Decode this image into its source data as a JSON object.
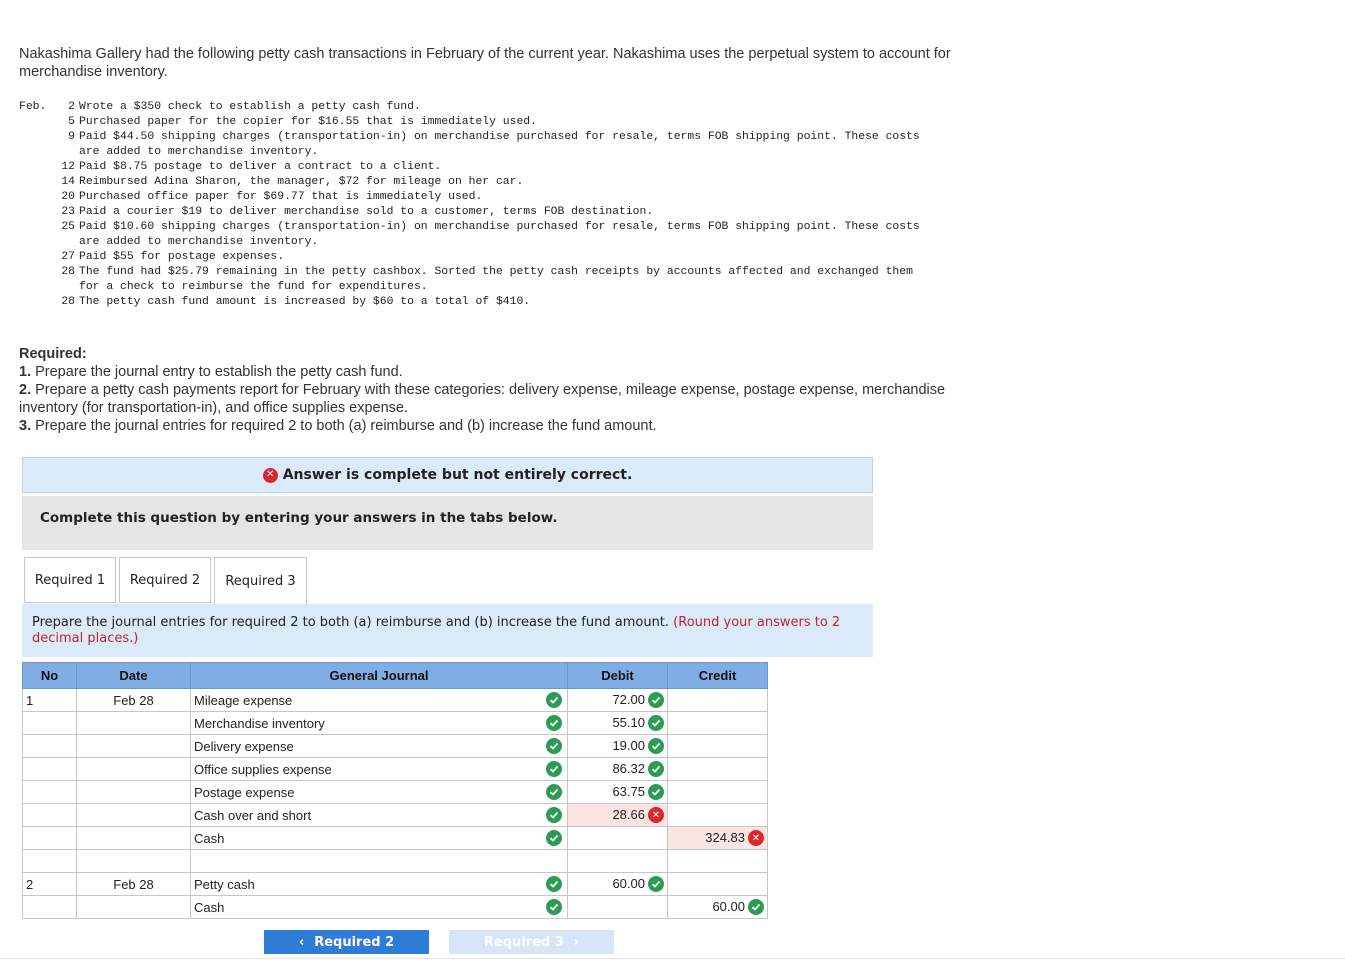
{
  "intro": "Nakashima Gallery had the following petty cash transactions in February of the current year. Nakashima uses the perpetual system to account for merchandise inventory.",
  "month": "Feb.",
  "transactions": [
    {
      "day": "2",
      "text": "Wrote a $350 check to establish a petty cash fund."
    },
    {
      "day": "5",
      "text": "Purchased paper for the copier for $16.55 that is immediately used."
    },
    {
      "day": "9",
      "text": "Paid $44.50 shipping charges (transportation-in) on merchandise purchased for resale, terms FOB shipping point. These costs\nare added to merchandise inventory."
    },
    {
      "day": "12",
      "text": "Paid $8.75 postage to deliver a contract to a client."
    },
    {
      "day": "14",
      "text": "Reimbursed Adina Sharon, the manager, $72 for mileage on her car."
    },
    {
      "day": "20",
      "text": "Purchased office paper for $69.77 that is immediately used."
    },
    {
      "day": "23",
      "text": "Paid a courier $19 to deliver merchandise sold to a customer, terms FOB destination."
    },
    {
      "day": "25",
      "text": "Paid $10.60 shipping charges (transportation-in) on merchandise purchased for resale, terms FOB shipping point. These costs\nare added to merchandise inventory."
    },
    {
      "day": "27",
      "text": "Paid $55 for postage expenses."
    },
    {
      "day": "28",
      "text": "The fund had $25.79 remaining in the petty cashbox. Sorted the petty cash receipts by accounts affected and exchanged them\nfor a check to reimburse the fund for expenditures."
    },
    {
      "day": "28",
      "text": "The petty cash fund amount is increased by $60 to a total of $410."
    }
  ],
  "required": {
    "heading": "Required:",
    "items": [
      {
        "num": "1.",
        "text": " Prepare the journal entry to establish the petty cash fund."
      },
      {
        "num": "2.",
        "text": " Prepare a petty cash payments report for February with these categories: delivery expense, mileage expense, postage expense, merchandise inventory (for transportation-in), and office supplies expense."
      },
      {
        "num": "3.",
        "text": " Prepare the journal entries for required 2 to both (a) reimburse and (b) increase the fund amount."
      }
    ]
  },
  "banner": "Answer is complete but not entirely correct.",
  "instruction": "Complete this question by entering your answers in the tabs below.",
  "tabs": [
    "Required 1",
    "Required 2",
    "Required 3"
  ],
  "prompt": {
    "main": "Prepare the journal entries for required 2 to both (a) reimburse and (b) increase the fund amount. ",
    "note": "(Round your answers to 2 decimal places.)"
  },
  "journal": {
    "headers": {
      "no": "No",
      "date": "Date",
      "account": "General Journal",
      "debit": "Debit",
      "credit": "Credit"
    },
    "rows": [
      {
        "no": "1",
        "date": "Feb 28",
        "account": "Mileage expense",
        "debit": "72.00",
        "credit": "",
        "status": "ok"
      },
      {
        "no": "",
        "date": "",
        "account": "Merchandise inventory",
        "debit": "55.10",
        "credit": "",
        "status": "ok"
      },
      {
        "no": "",
        "date": "",
        "account": "Delivery expense",
        "debit": "19.00",
        "credit": "",
        "status": "ok"
      },
      {
        "no": "",
        "date": "",
        "account": "Office supplies expense",
        "debit": "86.32",
        "credit": "",
        "status": "ok"
      },
      {
        "no": "",
        "date": "",
        "account": "Postage expense",
        "debit": "63.75",
        "credit": "",
        "status": "ok"
      },
      {
        "no": "",
        "date": "",
        "account": "Cash over and short",
        "debit": "28.66",
        "credit": "",
        "status": "bad-debit"
      },
      {
        "no": "",
        "date": "",
        "account": "Cash",
        "debit": "",
        "credit": "324.83",
        "status": "bad-credit",
        "indent": true
      },
      {
        "no": "2",
        "date": "Feb 28",
        "account": "Petty cash",
        "debit": "60.00",
        "credit": "",
        "status": "ok"
      },
      {
        "no": "",
        "date": "",
        "account": "Cash",
        "debit": "",
        "credit": "60.00",
        "status": "ok",
        "indent": true
      }
    ]
  },
  "nav": {
    "prev": "Required 2",
    "next": "Required 3"
  }
}
